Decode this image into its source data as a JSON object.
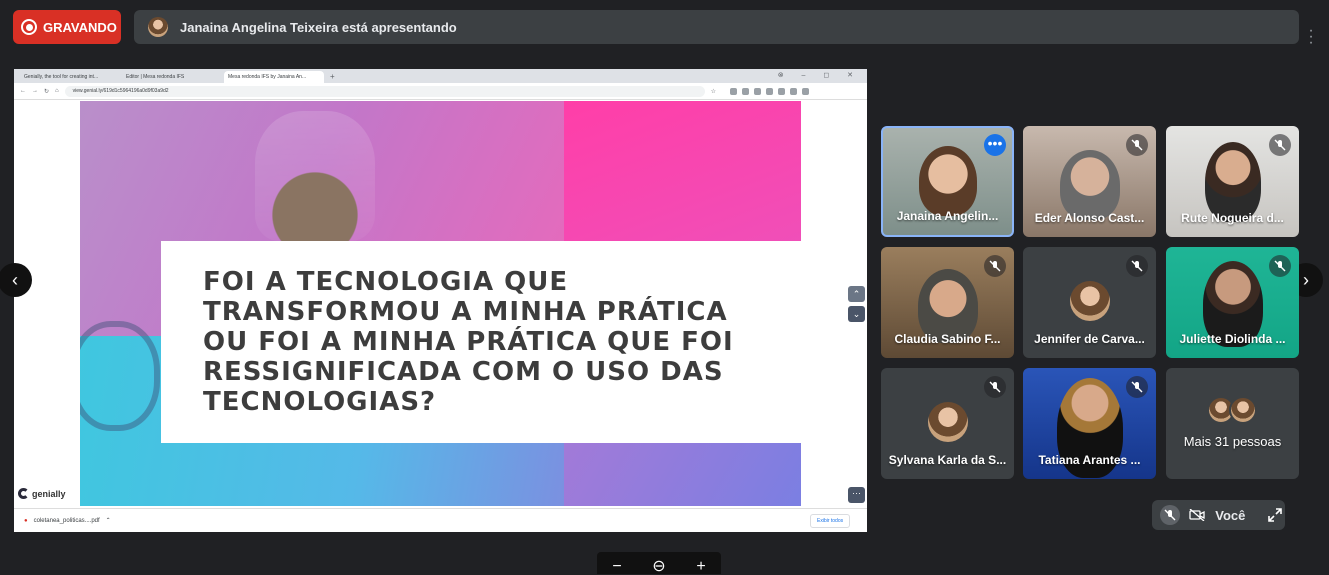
{
  "recording": {
    "label": "GRAVANDO",
    "color": "#d93025"
  },
  "presenter_bar": {
    "text": "Janaina Angelina Teixeira está apresentando"
  },
  "browser": {
    "tabs": [
      {
        "label": "Genially, the tool for creating int..."
      },
      {
        "label": "Editor | Mesa redonda IFS"
      },
      {
        "label": "Mesa redonda IFS by Janaina An..."
      }
    ],
    "url": "view.genial.ly/619d1c5964196a0d9f03a9d2",
    "window_controls": "⊗ – ◻ ✕"
  },
  "slide": {
    "question": "Foi a tecnologia que transformou a minha prática ou foi a minha prática que foi ressignificada com o uso das tecnologias?",
    "brand": "genially"
  },
  "download_bar": {
    "file": "coletanea_politicas....pdf",
    "show_all": "Exibir todos"
  },
  "participants": [
    {
      "name": "Janaina Angelin...",
      "muted": false,
      "active_speaker": true
    },
    {
      "name": "Eder Alonso Cast...",
      "muted": true
    },
    {
      "name": "Rute Nogueira d...",
      "muted": true
    },
    {
      "name": "Claudia Sabino F...",
      "muted": true
    },
    {
      "name": "Jennifer de Carva...",
      "muted": true
    },
    {
      "name": "Juliette Diolinda ...",
      "muted": true
    },
    {
      "name": "Sylvana Karla da S...",
      "muted": true
    },
    {
      "name": "Tatiana Arantes ...",
      "muted": true
    }
  ],
  "more_people": {
    "label": "Mais 31 pessoas"
  },
  "self_view": {
    "label": "Você"
  },
  "zoom_controls": [
    "−",
    "⊖",
    "+"
  ],
  "colors": {
    "accent": "#8ab4f8",
    "tile_bg": "#3c4043",
    "background": "#202124"
  }
}
